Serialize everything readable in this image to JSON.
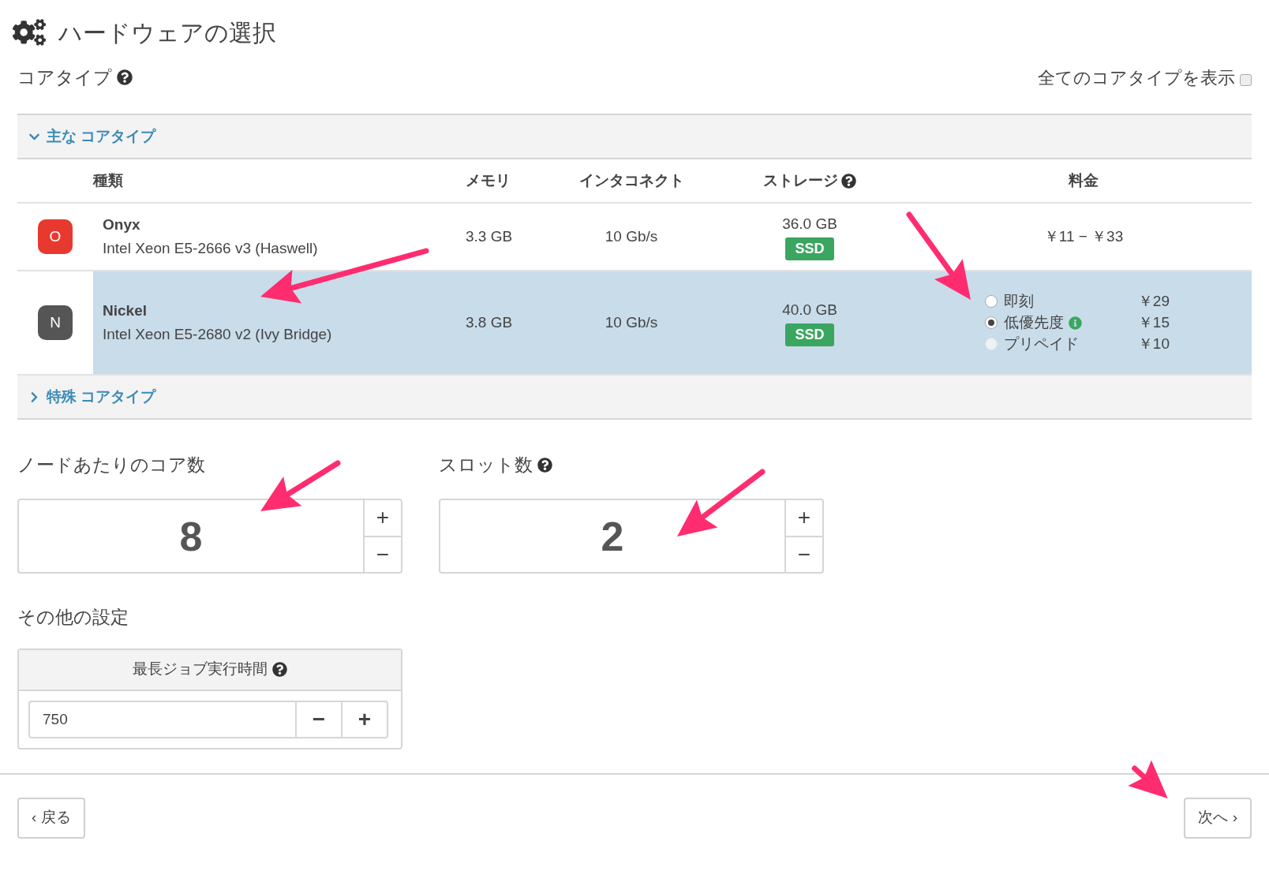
{
  "title": "ハードウェアの選択",
  "core_type": {
    "label": "コアタイプ",
    "show_all": {
      "label": "全てのコアタイプを表示",
      "checked": false
    }
  },
  "groups": [
    {
      "label": "主な コアタイプ",
      "expanded": true,
      "columns": [
        "種類",
        "メモリ",
        "インタコネクト",
        "ストレージ",
        "料金"
      ],
      "rows": [
        {
          "letter": "O",
          "color": "#e8392f",
          "name": "Onyx",
          "cpu": "Intel Xeon E5-2666 v3 (Haswell)",
          "memory": "3.3 GB",
          "interconnect": "10 Gb/s",
          "storage": "36.0 GB",
          "badge": "SSD",
          "selected": false,
          "pricing": {
            "kind": "range",
            "text": "￥11 − ￥33"
          }
        },
        {
          "letter": "N",
          "color": "#555555",
          "name": "Nickel",
          "cpu": "Intel Xeon E5-2680 v2 (Ivy Bridge)",
          "memory": "3.8 GB",
          "interconnect": "10 Gb/s",
          "storage": "40.0 GB",
          "badge": "SSD",
          "selected": true,
          "pricing": {
            "kind": "options",
            "options": [
              {
                "label": "即刻",
                "price": "￥29",
                "selected": false,
                "disabled": false,
                "info": false
              },
              {
                "label": "低優先度",
                "price": "￥15",
                "selected": true,
                "disabled": false,
                "info": true
              },
              {
                "label": "プリペイド",
                "price": "￥10",
                "selected": false,
                "disabled": true,
                "info": false
              }
            ]
          }
        }
      ]
    },
    {
      "label": "特殊 コアタイプ",
      "expanded": false
    }
  ],
  "steppers": [
    {
      "label": "ノードあたりのコア数",
      "help": false,
      "value": "8",
      "plus": "+",
      "minus": "−"
    },
    {
      "label": "スロット数",
      "help": true,
      "value": "2",
      "plus": "+",
      "minus": "−"
    }
  ],
  "other": {
    "label": "その他の設定",
    "max_runtime": {
      "label": "最長ジョブ実行時間",
      "value": "750",
      "minus": "−",
      "plus": "+"
    }
  },
  "footer": {
    "back": "‹ 戻る",
    "next": "次へ ›"
  }
}
